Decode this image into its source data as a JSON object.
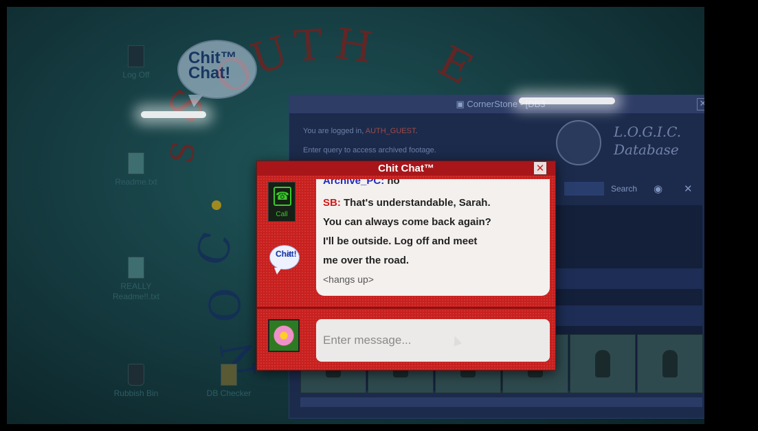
{
  "desktop": {
    "icons": [
      {
        "label": "Log Off"
      },
      {
        "label": "Readme.txt"
      },
      {
        "label_line1": "REALLY",
        "label_line2": "Readme!!.txt"
      },
      {
        "label": "Rubbish Bin"
      },
      {
        "label": "DB Checker"
      }
    ],
    "logo_text_line1": "Chit™",
    "logo_text_line2": "Chat!",
    "background_text": {
      "south": "SOUTH",
      "east": "E",
      "con": "CON"
    }
  },
  "cornerstone": {
    "title": "CornerStone - [DB3",
    "close_label": "✕",
    "login_prefix": "You are logged in, ",
    "login_user": "AUTH_GUEST",
    "login_suffix": ".",
    "prompt": "Enter query to access archived footage.",
    "db_title_line1": "L.O.G.I.C.",
    "db_title_line2": "Database",
    "search_label": "Search"
  },
  "chitchat": {
    "title": "Chit Chat™",
    "close_label": "✕",
    "call_label": "Call",
    "logo_line1": "Chit",
    "logo_line2": "Chat!",
    "messages": [
      {
        "sender": "Archive_PC:",
        "text": " no"
      },
      {
        "sender": "SB:",
        "text": " That's understandable, Sarah."
      },
      {
        "text": "You can always come back again?"
      },
      {
        "text": "I'll be outside. Log off and meet"
      },
      {
        "text": "me over the road."
      },
      {
        "text": "<hangs up>"
      }
    ],
    "input_placeholder": "Enter message...",
    "input_value": ""
  },
  "colors": {
    "chat_red": "#c8201e",
    "sender_blue": "#1a2cc0",
    "sender_red": "#cc1a18",
    "call_green": "#3acc2a"
  }
}
